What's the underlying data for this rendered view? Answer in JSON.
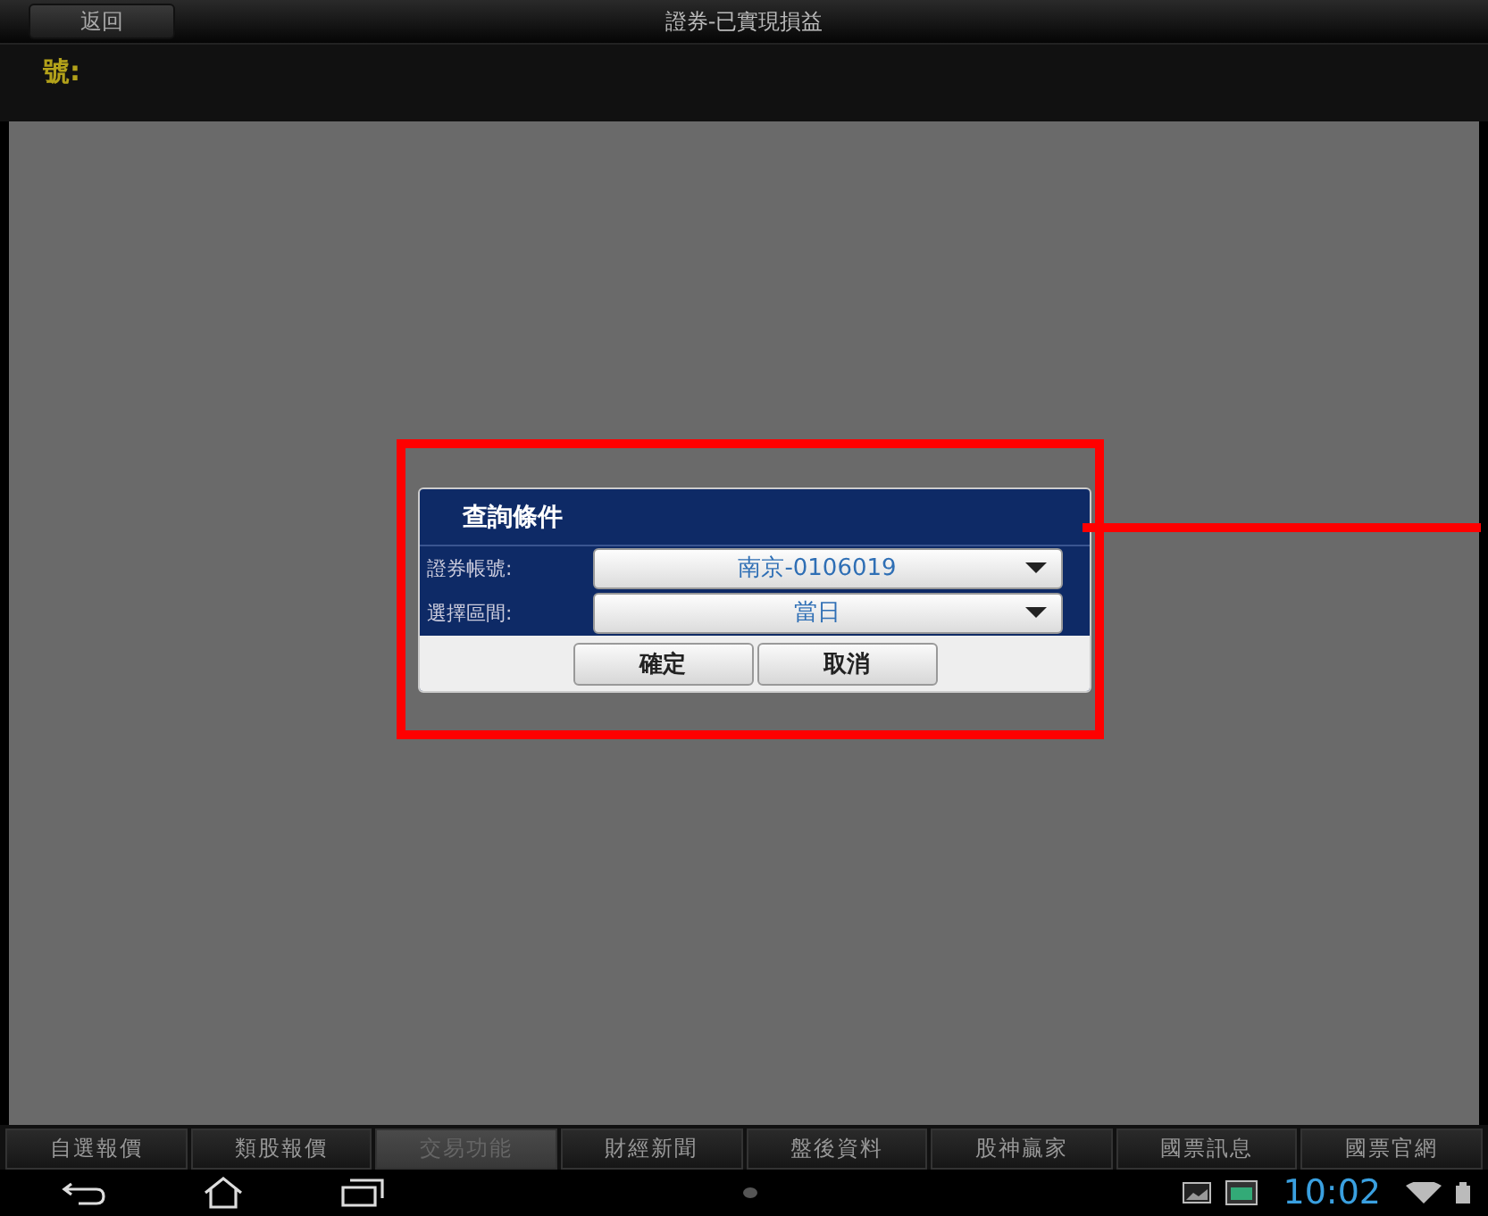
{
  "header": {
    "back_button": "返回",
    "title": "證券-已實現損益"
  },
  "account_label": "號:",
  "dialog": {
    "title": "查詢條件",
    "fields": [
      {
        "label": "證券帳號:",
        "value": "南京-0106019"
      },
      {
        "label": "選擇區間:",
        "value": "當日"
      }
    ],
    "buttons": [
      "確定",
      "取消"
    ]
  },
  "tabs": [
    {
      "label": "自選報價",
      "selected": false
    },
    {
      "label": "類股報價",
      "selected": false
    },
    {
      "label": "交易功能",
      "selected": true
    },
    {
      "label": "財經新聞",
      "selected": false
    },
    {
      "label": "盤後資料",
      "selected": false
    },
    {
      "label": "股神贏家",
      "selected": false
    },
    {
      "label": "國票訊息",
      "selected": false
    },
    {
      "label": "國票官網",
      "selected": false
    }
  ],
  "status_bar": {
    "time": "10:02"
  }
}
